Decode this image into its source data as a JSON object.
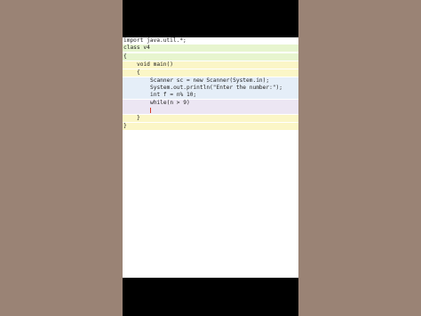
{
  "editor": {
    "lines": [
      "import java.util.*;",
      "class v4",
      "{",
      "void main()",
      "{",
      "Scanner sc = new Scanner(System.in);",
      "System.out.println(\"Enter the number:\");",
      "int f = n% 10;",
      "while(n > 9)",
      "",
      "}",
      "}"
    ]
  },
  "colors": {
    "background": "#9a8375",
    "green_highlight": "#e7f5cf",
    "yellow_highlight": "#fbf6c7",
    "blue_highlight": "#e5eef8",
    "lavender_highlight": "#ece6f3",
    "caret": "#d33a2a"
  }
}
